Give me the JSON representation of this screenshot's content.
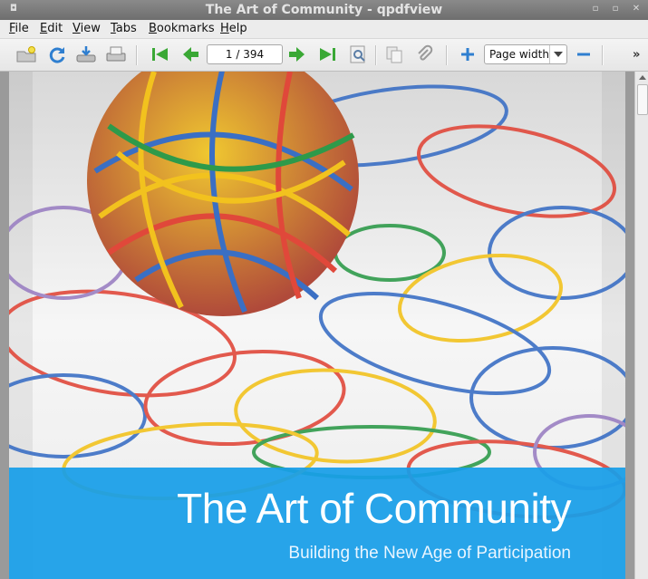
{
  "window": {
    "title": "The Art of Community - qpdfview"
  },
  "menu": [
    {
      "label": "File",
      "mnemonic": "F",
      "rest": "ile"
    },
    {
      "label": "Edit",
      "mnemonic": "E",
      "rest": "dit"
    },
    {
      "label": "View",
      "mnemonic": "V",
      "rest": "iew"
    },
    {
      "label": "Tabs",
      "mnemonic": "T",
      "rest": "abs"
    },
    {
      "label": "Bookmarks",
      "mnemonic": "B",
      "rest": "ookmarks"
    },
    {
      "label": "Help",
      "mnemonic": "H",
      "rest": "elp"
    }
  ],
  "toolbar": {
    "page_field": "1 / 394",
    "zoom_value": "Page width",
    "overflow": "»"
  },
  "document": {
    "title": "The Art of Community",
    "subtitle": "Building the New Age of Participation"
  },
  "colors": {
    "banner": "#189ee8",
    "toolbar_green": "#3aa835",
    "toolbar_blue": "#2f7fd0"
  }
}
